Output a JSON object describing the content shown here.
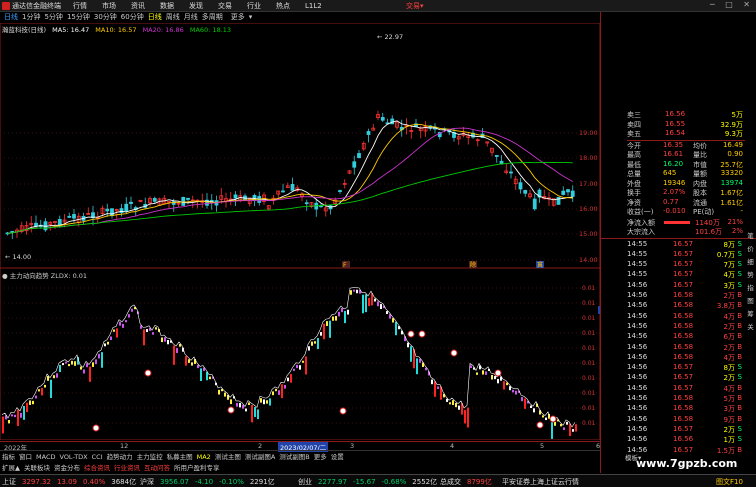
{
  "titlebar": {
    "app_name": "通达信金融终端",
    "menu": [
      "行情",
      "市场",
      "资讯",
      "数据",
      "发现",
      "交易",
      "行业",
      "热点",
      "L1L2"
    ],
    "trade_label": "交易",
    "menu_arrow": "▾",
    "window_controls": "─ □ ✕"
  },
  "periodbar": {
    "items": [
      "日线",
      "1分钟",
      "5分钟",
      "15分钟",
      "30分钟",
      "60分钟",
      "日线",
      "周线",
      "月线",
      "多周期",
      "更多"
    ],
    "active_index": 6,
    "marker": "▾"
  },
  "main_chart": {
    "stock_label": "瀚蓝科技(日线)",
    "ma_legend": [
      {
        "label": "MA5: 16.47",
        "color": "#ffffff"
      },
      {
        "label": "MA10: 16.57",
        "color": "#ffcc00"
      },
      {
        "label": "MA20: 16.86",
        "color": "#cc33cc"
      },
      {
        "label": "MA60: 18.13",
        "color": "#00cc00"
      }
    ],
    "price_axis": [
      "19.00",
      "18.00",
      "17.00",
      "16.00",
      "15.00",
      "14.00"
    ],
    "annotation_high": "22.97",
    "annotation_low": "14.00",
    "event_markers": [
      "F",
      "除",
      "冀"
    ],
    "colors": {
      "up": "#ff3333",
      "down": "#33ccdd",
      "ma5": "#ffffff",
      "ma10": "#ffcc00",
      "ma20": "#cc33cc",
      "ma60": "#00cc00"
    }
  },
  "sub_chart": {
    "legend": "● 主力动向趋势  ZLDX: 0.01",
    "axis_labels": [
      "0.01",
      "0.01",
      "0.01",
      "0.01",
      "0.01",
      "0.01",
      "0.01",
      "0.01",
      "0.01",
      "0.01"
    ],
    "cursor_label": "0.01"
  },
  "date_axis": {
    "labels": [
      "2022年",
      "12",
      "2",
      "3",
      "4",
      "5",
      "6"
    ],
    "cursor": "2023/02/07/二"
  },
  "indicator_tabs": [
    "指标",
    "窗口",
    "MACD",
    "VOL-TDX",
    "CCI",
    "趋势动力",
    "主力监控",
    "私募主图",
    "MA2",
    "测试主图",
    "测试副图A",
    "测试副图B",
    "更多",
    "设置"
  ],
  "indicator_active": "MA2",
  "ext_tabs": [
    {
      "label": "扩展▲",
      "red": false
    },
    {
      "label": "关联板块",
      "red": false
    },
    {
      "label": "资金分布",
      "red": false
    },
    {
      "label": "综合资讯",
      "red": true
    },
    {
      "label": "行业资讯",
      "red": true
    },
    {
      "label": "互动问答",
      "red": true
    },
    {
      "label": "所用户盈利专享",
      "red": false
    }
  ],
  "quote_panel": {
    "sell_levels": [
      {
        "label": "卖三",
        "price": "16.56",
        "vol": "5万"
      },
      {
        "label": "卖四",
        "price": "16.55",
        "vol": "32.9万"
      },
      {
        "label": "卖五",
        "price": "16.54",
        "vol": "9.3万"
      }
    ],
    "stats": [
      {
        "l1": "今开",
        "v1": "16.35",
        "l2": "均价",
        "v2": "16.49"
      },
      {
        "l1": "最高",
        "v1": "16.61",
        "l2": "量比",
        "v2": "0.90"
      },
      {
        "l1": "最低",
        "v1": "16.20",
        "l2": "市值",
        "v2": "25.7亿"
      },
      {
        "l1": "总量",
        "v1": "645",
        "l2": "量额",
        "v2": "33320"
      },
      {
        "l1": "外盘",
        "v1": "19346",
        "l2": "内盘",
        "v2": "13974"
      },
      {
        "l1": "换手",
        "v1": "2.07%",
        "l2": "股本",
        "v2": "1.67亿"
      },
      {
        "l1": "净资",
        "v1": "0.77",
        "l2": "流通",
        "v2": "1.61亿"
      },
      {
        "l1": "收益(一)",
        "v1": "-0.010",
        "l2": "PE(动)",
        "v2": "-"
      }
    ],
    "flows": [
      {
        "label": "净流入额",
        "value": "1140万",
        "pct": "21%"
      },
      {
        "label": "大宗流入",
        "value": "101.6万",
        "pct": "2%"
      }
    ],
    "ticks": [
      {
        "time": "14:55",
        "price": "16.57",
        "vol": "8万",
        "bs": "S"
      },
      {
        "time": "14:55",
        "price": "16.57",
        "vol": "0.7万",
        "bs": "S"
      },
      {
        "time": "14:55",
        "price": "16.57",
        "vol": "7万",
        "bs": "S"
      },
      {
        "time": "14:55",
        "price": "16.57",
        "vol": "4万",
        "bs": "S"
      },
      {
        "time": "14:56",
        "price": "16.57",
        "vol": "3万",
        "bs": "S"
      },
      {
        "time": "14:56",
        "price": "16.58",
        "vol": "2万",
        "bs": "B"
      },
      {
        "time": "14:56",
        "price": "16.58",
        "vol": "3.8万",
        "bs": "B"
      },
      {
        "time": "14:56",
        "price": "16.58",
        "vol": "4万",
        "bs": "B"
      },
      {
        "time": "14:56",
        "price": "16.58",
        "vol": "2万",
        "bs": "B"
      },
      {
        "time": "14:56",
        "price": "16.58",
        "vol": "6万",
        "bs": "B"
      },
      {
        "time": "14:56",
        "price": "16.58",
        "vol": "2万",
        "bs": "B"
      },
      {
        "time": "14:56",
        "price": "16.58",
        "vol": "4万",
        "bs": "B"
      },
      {
        "time": "14:56",
        "price": "16.57",
        "vol": "8万",
        "bs": "S"
      },
      {
        "time": "14:56",
        "price": "16.57",
        "vol": "2万",
        "bs": "S"
      },
      {
        "time": "14:56",
        "price": "16.57",
        "vol": "4万",
        "bs": "B"
      },
      {
        "time": "14:56",
        "price": "16.58",
        "vol": "5万",
        "bs": "B"
      },
      {
        "time": "14:56",
        "price": "16.58",
        "vol": "3万",
        "bs": "B"
      },
      {
        "time": "14:56",
        "price": "16.58",
        "vol": "9万",
        "bs": "B"
      },
      {
        "time": "14:56",
        "price": "16.57",
        "vol": "2万",
        "bs": "S"
      },
      {
        "time": "14:56",
        "price": "16.56",
        "vol": "1万",
        "bs": "S"
      },
      {
        "time": "14:56",
        "price": "16.57",
        "vol": "1.5万",
        "bs": "B"
      }
    ],
    "side_tabs": [
      "笔",
      "价",
      "细",
      "势",
      "指",
      "图",
      "筹",
      "关"
    ],
    "bottom_tabs": [
      "模板",
      "▾"
    ]
  },
  "statusbar": {
    "items": [
      {
        "label": "上证",
        "value": "3297.32",
        "chg": "13.09",
        "pct": "0.40%",
        "amt": "3684亿",
        "up": true
      },
      {
        "label": "沪深",
        "value": "3956.07",
        "chg": "-4.10",
        "pct": "-0.10%",
        "amt": "2291亿",
        "up": false
      },
      {
        "label": "创业",
        "value": "2277.97",
        "chg": "-15.67",
        "pct": "-0.68%",
        "amt": "2552亿",
        "up": false
      },
      {
        "label": "总成交",
        "value": "8799亿",
        "chg": "",
        "pct": "",
        "amt": "",
        "up": true
      }
    ],
    "feed_label": "平安证券上海上证云行情",
    "right_label": "图文F10"
  },
  "watermark": "www.7gpzb.com"
}
